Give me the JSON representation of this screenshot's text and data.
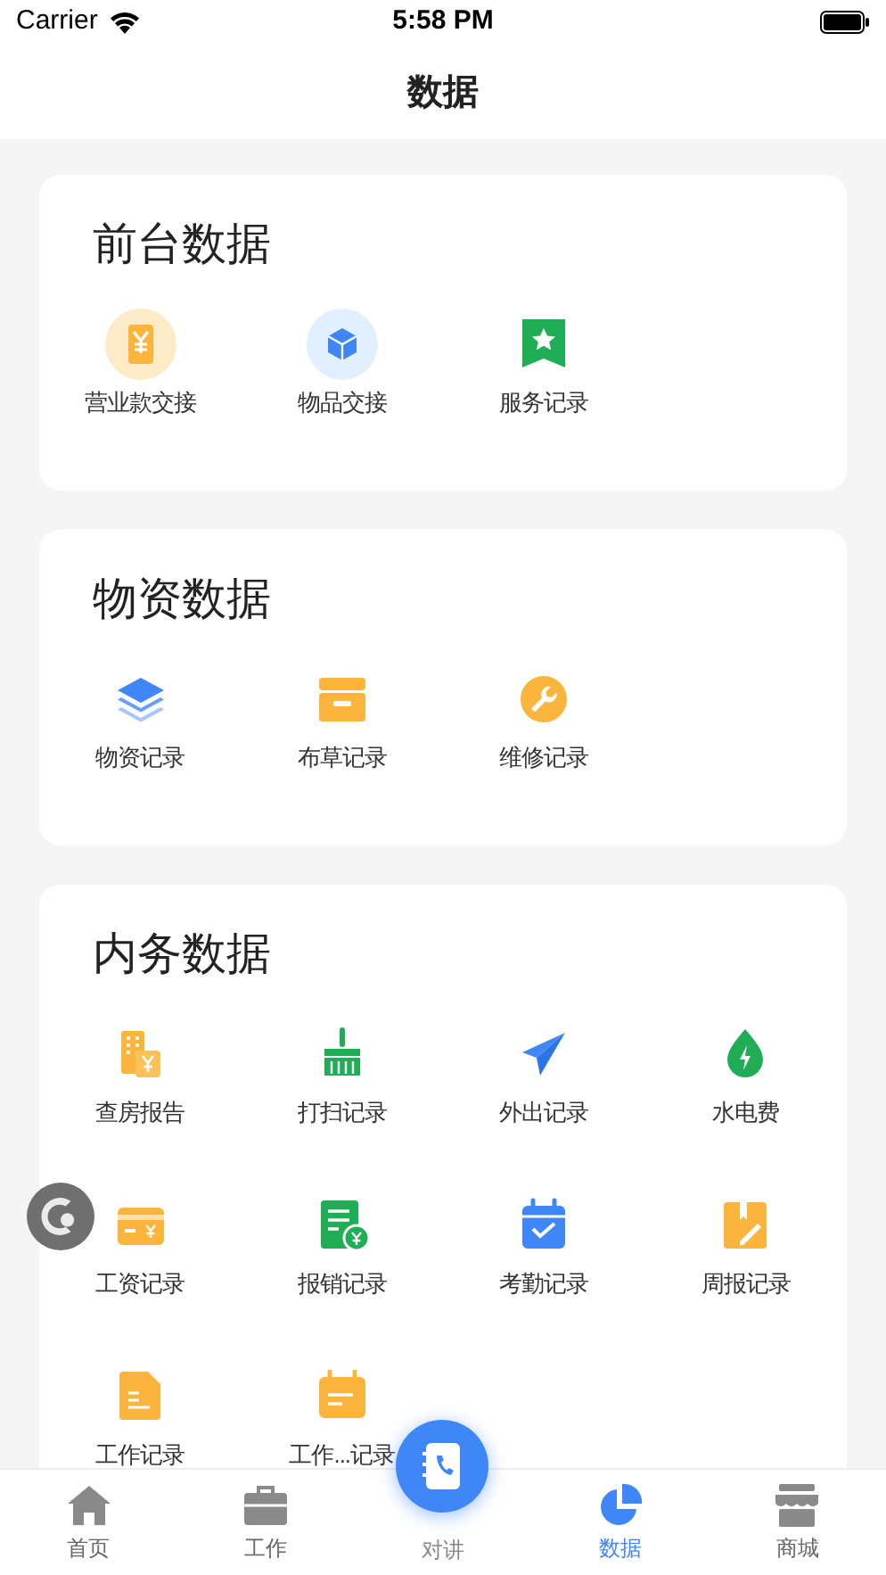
{
  "status_bar": {
    "carrier": "Carrier",
    "time": "5:58 PM"
  },
  "nav": {
    "title": "数据"
  },
  "sections": [
    {
      "title": "前台数据",
      "items": [
        {
          "label": "营业款交接"
        },
        {
          "label": "物品交接"
        },
        {
          "label": "服务记录"
        }
      ]
    },
    {
      "title": "物资数据",
      "items": [
        {
          "label": "物资记录"
        },
        {
          "label": "布草记录"
        },
        {
          "label": "维修记录"
        }
      ]
    },
    {
      "title": "内务数据",
      "items": [
        {
          "label": "查房报告"
        },
        {
          "label": "打扫记录"
        },
        {
          "label": "外出记录"
        },
        {
          "label": "水电费"
        },
        {
          "label": "工资记录"
        },
        {
          "label": "报销记录"
        },
        {
          "label": "考勤记录"
        },
        {
          "label": "周报记录"
        },
        {
          "label": "工作记录"
        },
        {
          "label": "工作...记录"
        }
      ]
    }
  ],
  "tab_bar": [
    {
      "label": "首页",
      "kind": "tab",
      "selected": false
    },
    {
      "label": "工作",
      "kind": "tab",
      "selected": false
    },
    {
      "label": "对讲",
      "kind": "fab",
      "selected": false
    },
    {
      "label": "数据",
      "kind": "tab",
      "selected": true
    },
    {
      "label": "商城",
      "kind": "tab",
      "selected": false
    }
  ]
}
